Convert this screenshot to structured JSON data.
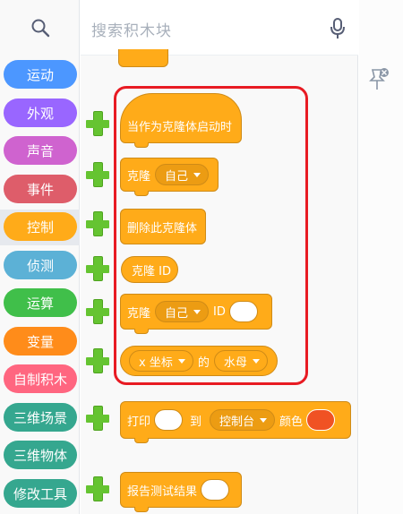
{
  "search": {
    "placeholder": "搜索积木块"
  },
  "categories": [
    {
      "label": "运动",
      "color": "#4c97ff"
    },
    {
      "label": "外观",
      "color": "#9966ff"
    },
    {
      "label": "声音",
      "color": "#cf63cf"
    },
    {
      "label": "事件",
      "color": "#de5d6a"
    },
    {
      "label": "控制",
      "color": "#ffab19"
    },
    {
      "label": "侦测",
      "color": "#5cb1d6"
    },
    {
      "label": "运算",
      "color": "#40bf4a"
    },
    {
      "label": "变量",
      "color": "#ff8c1a"
    },
    {
      "label": "自制积木",
      "color": "#ff6680"
    },
    {
      "label": "三维场景",
      "color": "#35a78f"
    },
    {
      "label": "三维物体",
      "color": "#35a78f"
    },
    {
      "label": "修改工具",
      "color": "#35a78f"
    }
  ],
  "blocks": {
    "clone_start": {
      "text": "当作为克隆体启动时"
    },
    "clone": {
      "text": "克隆",
      "option": "自己"
    },
    "delete_clone": {
      "text": "删除此克隆体"
    },
    "clone_id": {
      "text": "克隆 ID"
    },
    "clone_with_id": {
      "text": "克隆",
      "option": "自己",
      "id_label": "ID"
    },
    "xcoord": {
      "prop": "x 坐标",
      "of": "的",
      "target": "水母"
    },
    "print": {
      "text": "打印",
      "to": "到",
      "dest": "控制台",
      "color_label": "颜色",
      "color_value": "#f05223"
    },
    "report": {
      "text": "报告测试结果"
    }
  },
  "colors": {
    "control": "#ffab19",
    "highlight": "#e81b23",
    "add": "#65c431"
  }
}
